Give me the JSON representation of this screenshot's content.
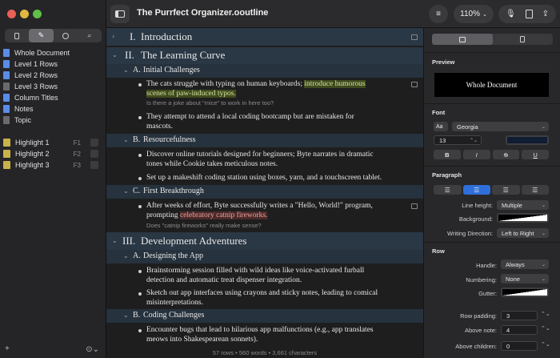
{
  "window": {
    "title": "The Purrfect Organizer.ooutline"
  },
  "toolbar": {
    "zoom": "110%"
  },
  "sidebar": {
    "items": [
      {
        "label": "Whole Document",
        "color": "#5b8ce8"
      },
      {
        "label": "Level 1 Rows",
        "color": "#5b8ce8"
      },
      {
        "label": "Level 2 Rows",
        "color": "#5b8ce8"
      },
      {
        "label": "Level 3 Rows",
        "color": "#5b8ce8"
      },
      {
        "label": "Column Titles",
        "color": "#5b8ce8"
      },
      {
        "label": "Notes",
        "color": "#6a6a6e"
      },
      {
        "label": "Topic",
        "color": "#6a6a6e"
      }
    ],
    "highlights": [
      {
        "label": "Highlight 1",
        "key": "F1"
      },
      {
        "label": "Highlight 2",
        "key": "F2"
      },
      {
        "label": "Highlight 3",
        "key": "F3"
      }
    ]
  },
  "outline": {
    "r1": {
      "num": "I.",
      "text": "Introduction"
    },
    "r2": {
      "num": "II.",
      "text": "The Learning Curve"
    },
    "r3": {
      "num": "A.",
      "text": "Initial Challenges"
    },
    "r4": {
      "a": "The cats struggle with typing on human keyboards;",
      "hl": "introduce humorous",
      "hl2": "scenes of paw-induced typos."
    },
    "r4n": "Is there a joke about \"mice\" to work in here too?",
    "r5": {
      "a": "They attempt to attend a local coding bootcamp but are mistaken for",
      "b": "mascots."
    },
    "r6": {
      "num": "B.",
      "text": "Resourcefulness"
    },
    "r7": {
      "a": "Discover online tutorials designed for beginners; Byte narrates in dramatic",
      "b": "tones while Cookie takes meticulous notes."
    },
    "r8": {
      "a": "Set up a makeshift coding station using boxes, yarn, and a touchscreen tablet."
    },
    "r9": {
      "num": "C.",
      "text": "First Breakthrough"
    },
    "r10": {
      "a": "After weeks of effort, Byte successfully writes a \"Hello, World!\" program,",
      "b": "prompting",
      "hl": "celebratory catnip fireworks."
    },
    "r10n": "Does  \"catnip fireworks\" really make sense?",
    "r11": {
      "num": "III.",
      "text": "Development Adventures"
    },
    "r12": {
      "num": "A.",
      "text": "Designing the App"
    },
    "r13": {
      "a": "Brainstorming session filled with wild ideas like voice-activated furball",
      "b": "detection and automatic treat dispenser integration."
    },
    "r14": {
      "a": "Sketch out app interfaces using crayons and sticky notes, leading to comical",
      "b": "misinterpretations."
    },
    "r15": {
      "num": "B.",
      "text": "Coding Challenges"
    },
    "r16": {
      "a": "Encounter bugs that lead to hilarious app malfunctions (e.g., app translates",
      "b": "meows into Shakespearean sonnets)."
    }
  },
  "status": "57 rows • 560 words • 3,661 characters",
  "inspector": {
    "preview": {
      "heading": "Preview",
      "sample": "Whole Document"
    },
    "font": {
      "heading": "Font",
      "aa": "Aa",
      "family": "Georgia",
      "size": "13",
      "bold": "B",
      "italic": "I",
      "strike": "S",
      "underline": "U",
      "color": "#0f1d33"
    },
    "paragraph": {
      "heading": "Paragraph",
      "line_height_label": "Line height:",
      "line_height": "Multiple",
      "background_label": "Background:",
      "direction_label": "Writing Direction:",
      "direction": "Left to Right"
    },
    "row": {
      "heading": "Row",
      "handle_label": "Handle:",
      "handle": "Always",
      "numbering_label": "Numbering:",
      "numbering": "None",
      "gutter_label": "Gutter:",
      "padding_label": "Row padding:",
      "padding": "3",
      "above_note_label": "Above note:",
      "above_note": "4",
      "above_children_label": "Above children:",
      "above_children": "0"
    }
  }
}
